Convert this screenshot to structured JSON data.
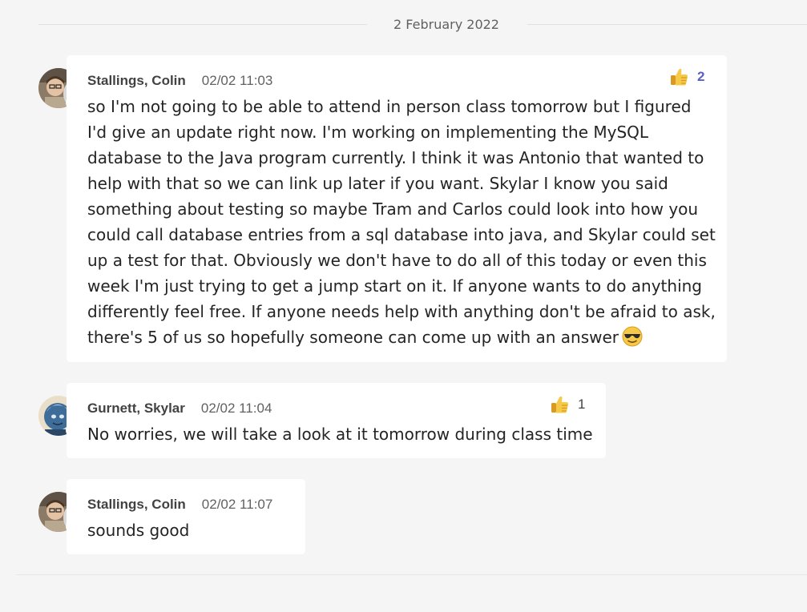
{
  "divider": {
    "date": "2 February 2022"
  },
  "messages": [
    {
      "author": "Stallings, Colin",
      "time": "02/02 11:03",
      "presence": "available",
      "text": "so I'm not going to be able to attend in person class tomorrow but I figured\nI'd give an update right now. I'm working on implementing the MySQL\ndatabase to the Java program currently. I think it was Antonio that wanted to\nhelp with that so we can link up later if you want. Skylar I know you said\nsomething about testing so maybe Tram and Carlos could look into how you\ncould call database entries from a sql database into java, and Skylar could set\nup a test for that. Obviously we don't have to do all of this today or even this\nweek I'm just trying to get a jump start on it. If anyone wants to do anything\ndifferently feel free. If anyone needs help with anything don't be afraid to ask,\nthere's 5 of us so hopefully someone can come up with an answer",
      "trailing_emoji": "sunglasses-emoji",
      "reaction": {
        "icon": "thumbs-up-icon",
        "count": "2",
        "mine": true
      }
    },
    {
      "author": "Gurnett, Skylar",
      "time": "02/02 11:04",
      "presence": "away",
      "text": "No worries, we will take a look at it tomorrow during class time",
      "reaction": {
        "icon": "thumbs-up-icon",
        "count": "1",
        "mine": false
      }
    },
    {
      "author": "Stallings, Colin",
      "time": "02/02 11:07",
      "presence": "available",
      "text": "sounds good"
    }
  ],
  "colors": {
    "background": "#f5f5f5",
    "card": "#ffffff",
    "presence_available": "#92c353",
    "presence_away": "#f8d22a",
    "reaction_mine": "#5b5fc7"
  }
}
